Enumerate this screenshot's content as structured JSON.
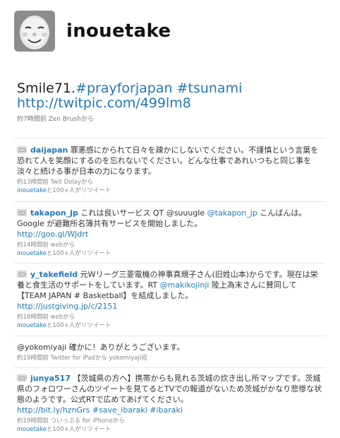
{
  "header": {
    "username": "inouetake"
  },
  "main_tweet": {
    "line1_text": "Smile71.",
    "hashtag1": "#prayforjapan",
    "hashtag2": "#tsunami",
    "url": "http://twitpic.com/499lm8",
    "meta": "約7時間前 Zen Brushから"
  },
  "tweets": [
    {
      "user": "daijapan",
      "text": "罪悪感にかられて日々を疎かにしないでください。不謹慎という言葉を恐れて人を笑顔にするのを忘れないでください。どんな仕事であれいつもと同じ事を淡々と続ける事が日本の力になります。",
      "meta": "約13時間前 Twit Delayから",
      "rt_user": "inouetake",
      "rt_suffix": "と100+人がリツイート"
    },
    {
      "user": "takapon_jp",
      "text_part1": "これは良いサービス QT @suuugle ",
      "mention": "@takapon_jp",
      "text_part2": " こんばんは。Google が避難所名簿共有サービスを開始しました。",
      "url": "http://goo.gl/WJdrt",
      "meta": "約14時間前 webから",
      "rt_user": "inouetake",
      "rt_suffix": "と100+人がリツイート"
    },
    {
      "user": "y_takefield",
      "text_part1": "元Wリーグ三菱電機の神事真規子さん(旧姓山本)からです。現在は栄養と食生活のサポートをしています。RT ",
      "mention": "@makikojinji",
      "text_part2": " 陸上為末さんに賛同して【TEAM JAPAN # Basketball】を結成しました。",
      "url": "http://justgiving.jp/c/2151",
      "meta": "約18時間前 webから",
      "rt_user": "inouetake",
      "rt_suffix": "と100+人がリツイート"
    },
    {
      "user": "@yokomiyaji",
      "text": "確かに！ありがとうございます。",
      "meta": "約19時間前 Twitter for iPadから yokomiyaji宛"
    },
    {
      "user": "junya517",
      "text": "【茨城県の方へ】携帯からも見れる茨城の炊き出し所マップです。茨城県のフォロワーさんのツイートを見てるとTVでの報道がないため茨城がかなり悲惨な状態のようです。公式RTで広めてあげてください。",
      "url": "http://bit.ly/hznGrs",
      "hashtag1": "#save_ibaraki",
      "hashtag2": "#ibaraki",
      "meta": "約19時間前 ついっぷる for iPhoneから",
      "rt_user": "inouetake",
      "rt_suffix": "と100+人がリツイート"
    }
  ]
}
